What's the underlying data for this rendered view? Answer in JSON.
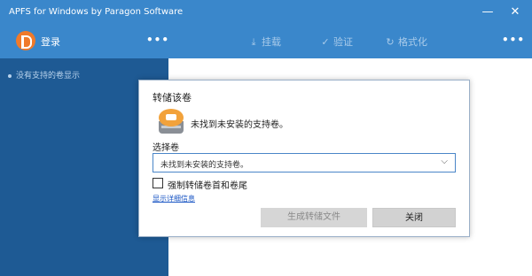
{
  "window": {
    "title": "APFS for Windows by Paragon Software",
    "minimize_glyph": "—",
    "close_glyph": "✕"
  },
  "toolbar": {
    "login_label": "登录",
    "more_glyph": "•••",
    "mount_label": "挂载",
    "verify_label": "验证",
    "format_label": "格式化",
    "mount_icon": "download-icon",
    "verify_icon": "check-icon",
    "format_icon": "refresh-icon"
  },
  "sidebar": {
    "empty_text": "没有支持的卷显示"
  },
  "dialog": {
    "title": "转储该卷",
    "not_found": "未找到未安装的支持卷。",
    "select_label": "选择卷",
    "select_value": "未找到未安装的支持卷。",
    "checkbox_label": "强制转储卷首和卷尾",
    "details_link": "显示详细信息",
    "generate_button": "生成转储文件",
    "close_button": "关闭"
  },
  "colors": {
    "titlebar": "#3a87cb",
    "sidebar": "#1e5a94",
    "logo": "#f07a2a",
    "link": "#1a56c4"
  }
}
